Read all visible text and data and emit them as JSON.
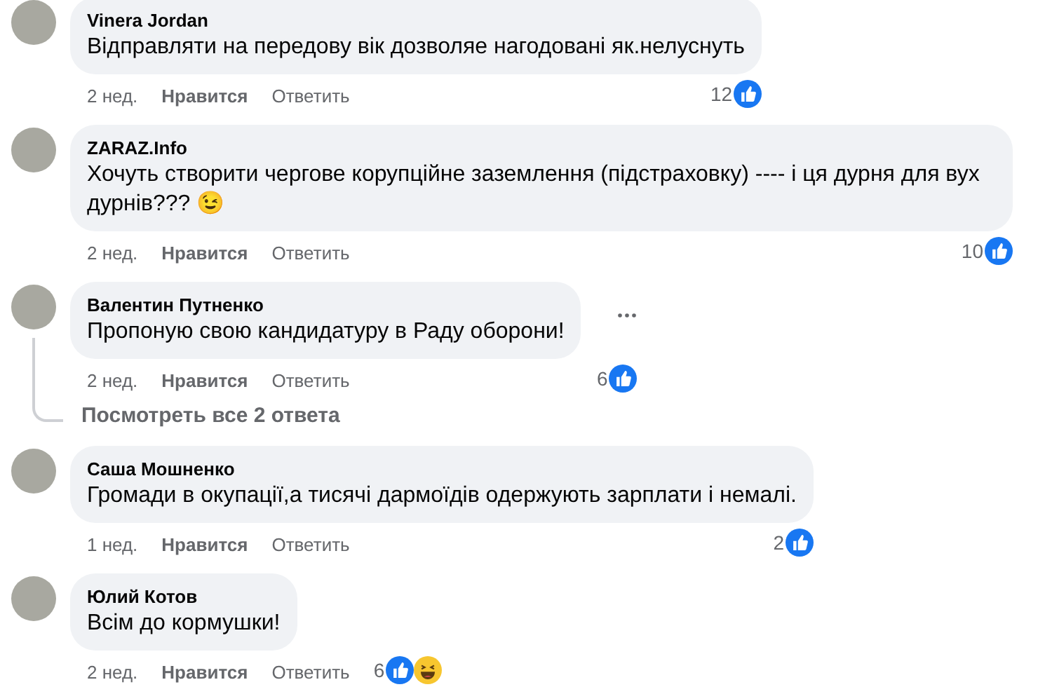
{
  "comments": [
    {
      "author": "Vinera Jordan",
      "text": "Відправляти на передову вік дозволяе нагодовані як.нелуснуть",
      "time": "2 нед.",
      "like_label": "Нравится",
      "reply_label": "Ответить",
      "reaction_count": "12",
      "reactions": [
        {
          "kind": "like"
        }
      ],
      "menu_visible": false
    },
    {
      "author": "ZARAZ.Info",
      "text": "Хочуть створити чергове корупційне заземлення (підстраховку) ---- і ця дурня для вух дурнів??? 😉",
      "time": "2 нед.",
      "like_label": "Нравится",
      "reply_label": "Ответить",
      "reaction_count": "10",
      "reactions": [
        {
          "kind": "like"
        }
      ],
      "menu_visible": false
    },
    {
      "author": "Валентин Путненко",
      "text": "Пропоную свою кандидатуру в Раду оборони!",
      "time": "2 нед.",
      "like_label": "Нравится",
      "reply_label": "Ответить",
      "reaction_count": "6",
      "reactions": [
        {
          "kind": "like"
        }
      ],
      "menu_visible": true,
      "replies_link": "Посмотреть все 2 ответа"
    },
    {
      "author": "Саша Мошненко",
      "text": "Громади в окупації,а тисячі дармоїдів одержують зарплати і немалі.",
      "time": "1 нед.",
      "like_label": "Нравится",
      "reply_label": "Ответить",
      "reaction_count": "2",
      "reactions": [
        {
          "kind": "like"
        }
      ],
      "menu_visible": false
    },
    {
      "author": "Юлий Котов",
      "text": "Всім до кормушки!",
      "time": "2 нед.",
      "like_label": "Нравится",
      "reply_label": "Ответить",
      "reaction_count": "6",
      "reactions": [
        {
          "kind": "like"
        },
        {
          "kind": "haha"
        }
      ],
      "menu_visible": false
    }
  ]
}
